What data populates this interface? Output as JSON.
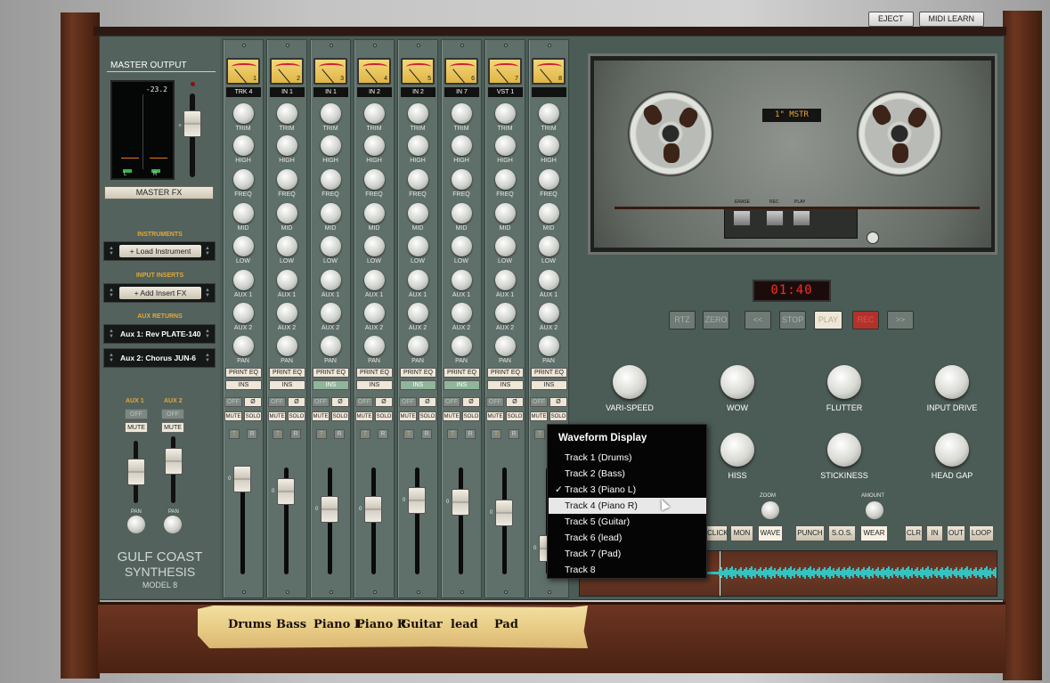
{
  "top_buttons": {
    "eject": "EJECT",
    "midi_learn": "MIDI LEARN"
  },
  "master": {
    "title": "MASTER OUTPUT",
    "level": "-23.2",
    "left": "L",
    "right": "R",
    "fx": "MASTER FX",
    "fader_mark": "+"
  },
  "sections": {
    "instruments": "INSTRUMENTS",
    "load_instrument": "+ Load Instrument",
    "input_inserts": "INPUT INSERTS",
    "add_insert": "+ Add Insert FX",
    "aux_returns": "AUX RETURNS",
    "aux1": "Aux 1: Rev PLATE-140",
    "aux2": "Aux 2: Chorus JUN-6"
  },
  "aux_controls": {
    "aux1": "AUX 1",
    "aux2": "AUX 2",
    "off": "OFF",
    "mute": "MUTE",
    "pan": "PAN"
  },
  "brand": {
    "line1": "GULF COAST",
    "line2": "SYNTHESIS",
    "line3": "MODEL 8"
  },
  "knob_labels": [
    "TRIM",
    "HIGH",
    "FREQ",
    "MID",
    "LOW",
    "AUX 1",
    "AUX 2",
    "PAN"
  ],
  "strip_buttons": {
    "print_eq": "PRINT EQ",
    "ins": "INS",
    "off": "OFF",
    "phase": "Ø",
    "mute": "MUTE",
    "solo": "SOLO",
    "t": "T",
    "r": "R",
    "zero": "0"
  },
  "channels": [
    {
      "num": "1",
      "input": "TRK 4",
      "ins_active": false
    },
    {
      "num": "2",
      "input": "IN 1",
      "ins_active": false
    },
    {
      "num": "3",
      "input": "IN 1",
      "ins_active": true
    },
    {
      "num": "4",
      "input": "IN 2",
      "ins_active": false
    },
    {
      "num": "5",
      "input": "IN 2",
      "ins_active": true
    },
    {
      "num": "6",
      "input": "IN 7",
      "ins_active": true
    },
    {
      "num": "7",
      "input": "VST 1",
      "ins_active": false
    },
    {
      "num": "8",
      "input": "",
      "ins_active": false
    }
  ],
  "tape": {
    "label": "1\" MSTR",
    "erase": "ERASE",
    "rec": "REC",
    "play": "PLAY",
    "counter": "01:40"
  },
  "transport": [
    "RTZ",
    "ZERO",
    "<<",
    "STOP",
    "PLAY",
    "REC",
    ">>"
  ],
  "tape_knobs": [
    "VARI-SPEED",
    "WOW",
    "FLUTTER",
    "INPUT DRIVE",
    "HISS",
    "STICKINESS",
    "HEAD GAP"
  ],
  "wave_controls": {
    "zoom": "ZOOM",
    "amount": "AMOUNT",
    "buttons": [
      "CLICK",
      "MON",
      "WAVE",
      "PUNCH",
      "S.O.S.",
      "WEAR",
      "CLR",
      "IN",
      "OUT",
      "LOOP"
    ]
  },
  "menu": {
    "title": "Waveform Display",
    "items": [
      "Track 1 (Drums)",
      "Track 2 (Bass)",
      "Track 3 (Piano L)",
      "Track 4 (Piano R)",
      "Track 5 (Guitar)",
      "Track 6 (lead)",
      "Track 7 (Pad)",
      "Track 8"
    ],
    "checked": "✓",
    "checked_index": 2,
    "highlighted_index": 3
  },
  "tape_strip": [
    "Drums",
    "Bass",
    "Piano L",
    "Piano R",
    "Guitar",
    "lead",
    "Pad"
  ],
  "colors": {
    "panel": "#4b5b55",
    "accent": "#e3a73a",
    "counter": "#ff2a20",
    "wave": "#35c2c0",
    "ins_active": "#8fb59a"
  }
}
